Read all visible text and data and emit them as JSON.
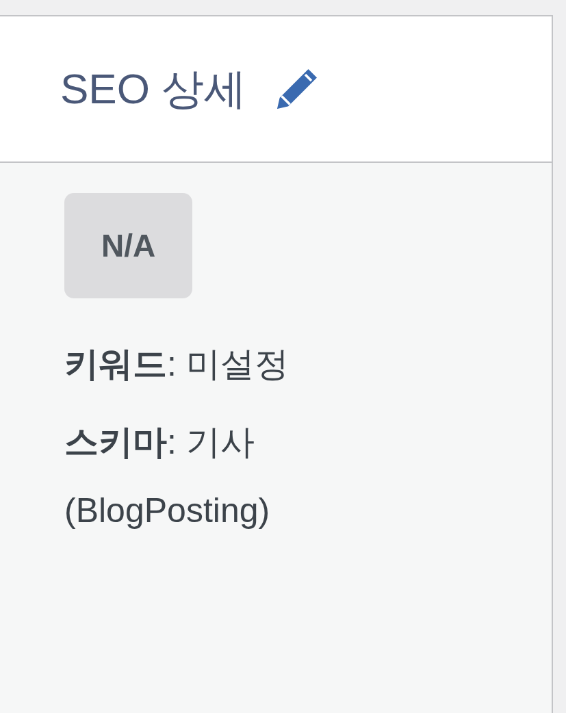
{
  "panel": {
    "title": "SEO 상세",
    "badge": "N/A",
    "details": [
      "**키워드**: 미설정",
      "**스키마**: 기사 (BlogPosting)"
    ]
  }
}
